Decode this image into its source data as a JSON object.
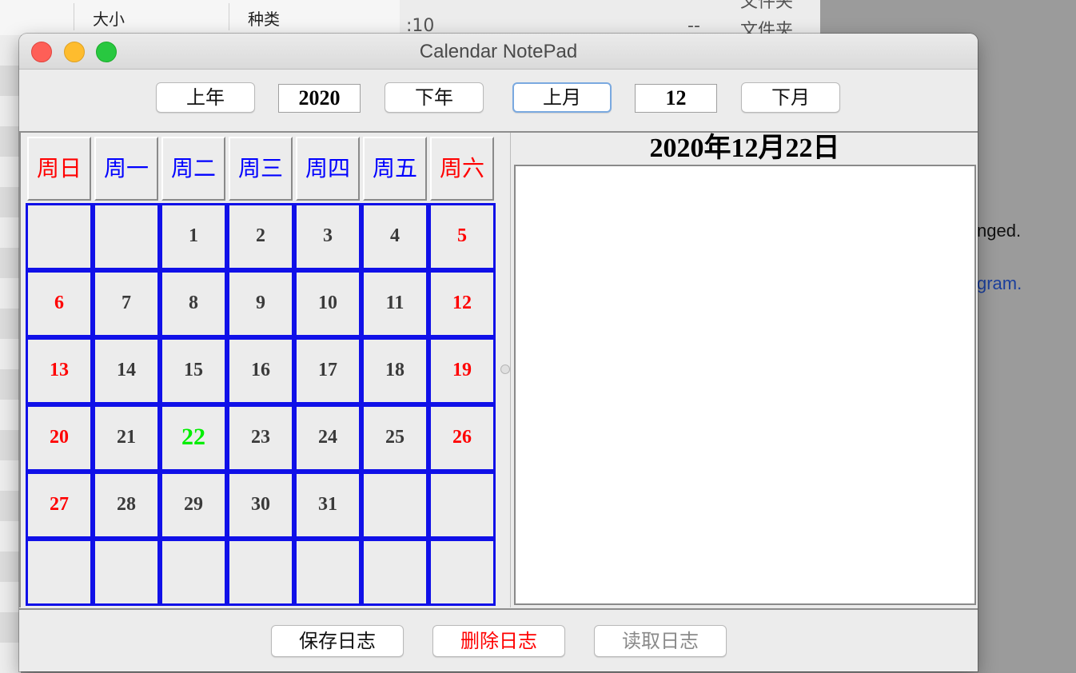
{
  "background": {
    "finder_header": {
      "col_size": "大小",
      "col_kind": "种类"
    },
    "second_window": {
      "time_fragment": ":10",
      "dash": "--",
      "kind_value": "文件夹",
      "kind_value_top": "文件夹"
    },
    "doc_fragments": {
      "line1": "nged.",
      "line2": "gram."
    }
  },
  "window": {
    "title": "Calendar NotePad"
  },
  "toolbar": {
    "prev_year_label": "上年",
    "year_value": "2020",
    "next_year_label": "下年",
    "prev_month_label": "上月",
    "month_value": "12",
    "next_month_label": "下月"
  },
  "calendar": {
    "weekdays": [
      {
        "label": "周日",
        "color": "#ff0000"
      },
      {
        "label": "周一",
        "color": "#0000ff"
      },
      {
        "label": "周二",
        "color": "#0000ff"
      },
      {
        "label": "周三",
        "color": "#0000ff"
      },
      {
        "label": "周四",
        "color": "#0000ff"
      },
      {
        "label": "周五",
        "color": "#0000ff"
      },
      {
        "label": "周六",
        "color": "#ff0000"
      }
    ],
    "weeks": [
      [
        "",
        "",
        "1",
        "2",
        "3",
        "4",
        "5"
      ],
      [
        "6",
        "7",
        "8",
        "9",
        "10",
        "11",
        "12"
      ],
      [
        "13",
        "14",
        "15",
        "16",
        "17",
        "18",
        "19"
      ],
      [
        "20",
        "21",
        "22",
        "23",
        "24",
        "25",
        "26"
      ],
      [
        "27",
        "28",
        "29",
        "30",
        "31",
        "",
        ""
      ],
      [
        "",
        "",
        "",
        "",
        "",
        "",
        ""
      ]
    ],
    "selected_day": "22",
    "colors": {
      "weekend": "#ff0000",
      "weekday": "#3a3a3a",
      "selected": "#00ee00",
      "grid": "#1010e8"
    }
  },
  "notes": {
    "date_title": "2020年12月22日",
    "content": ""
  },
  "actions": {
    "save_label": "保存日志",
    "delete_label": "删除日志",
    "read_label": "读取日志",
    "colors": {
      "save": "#111111",
      "delete": "#ff0000",
      "read": "#8a8a8a"
    }
  }
}
